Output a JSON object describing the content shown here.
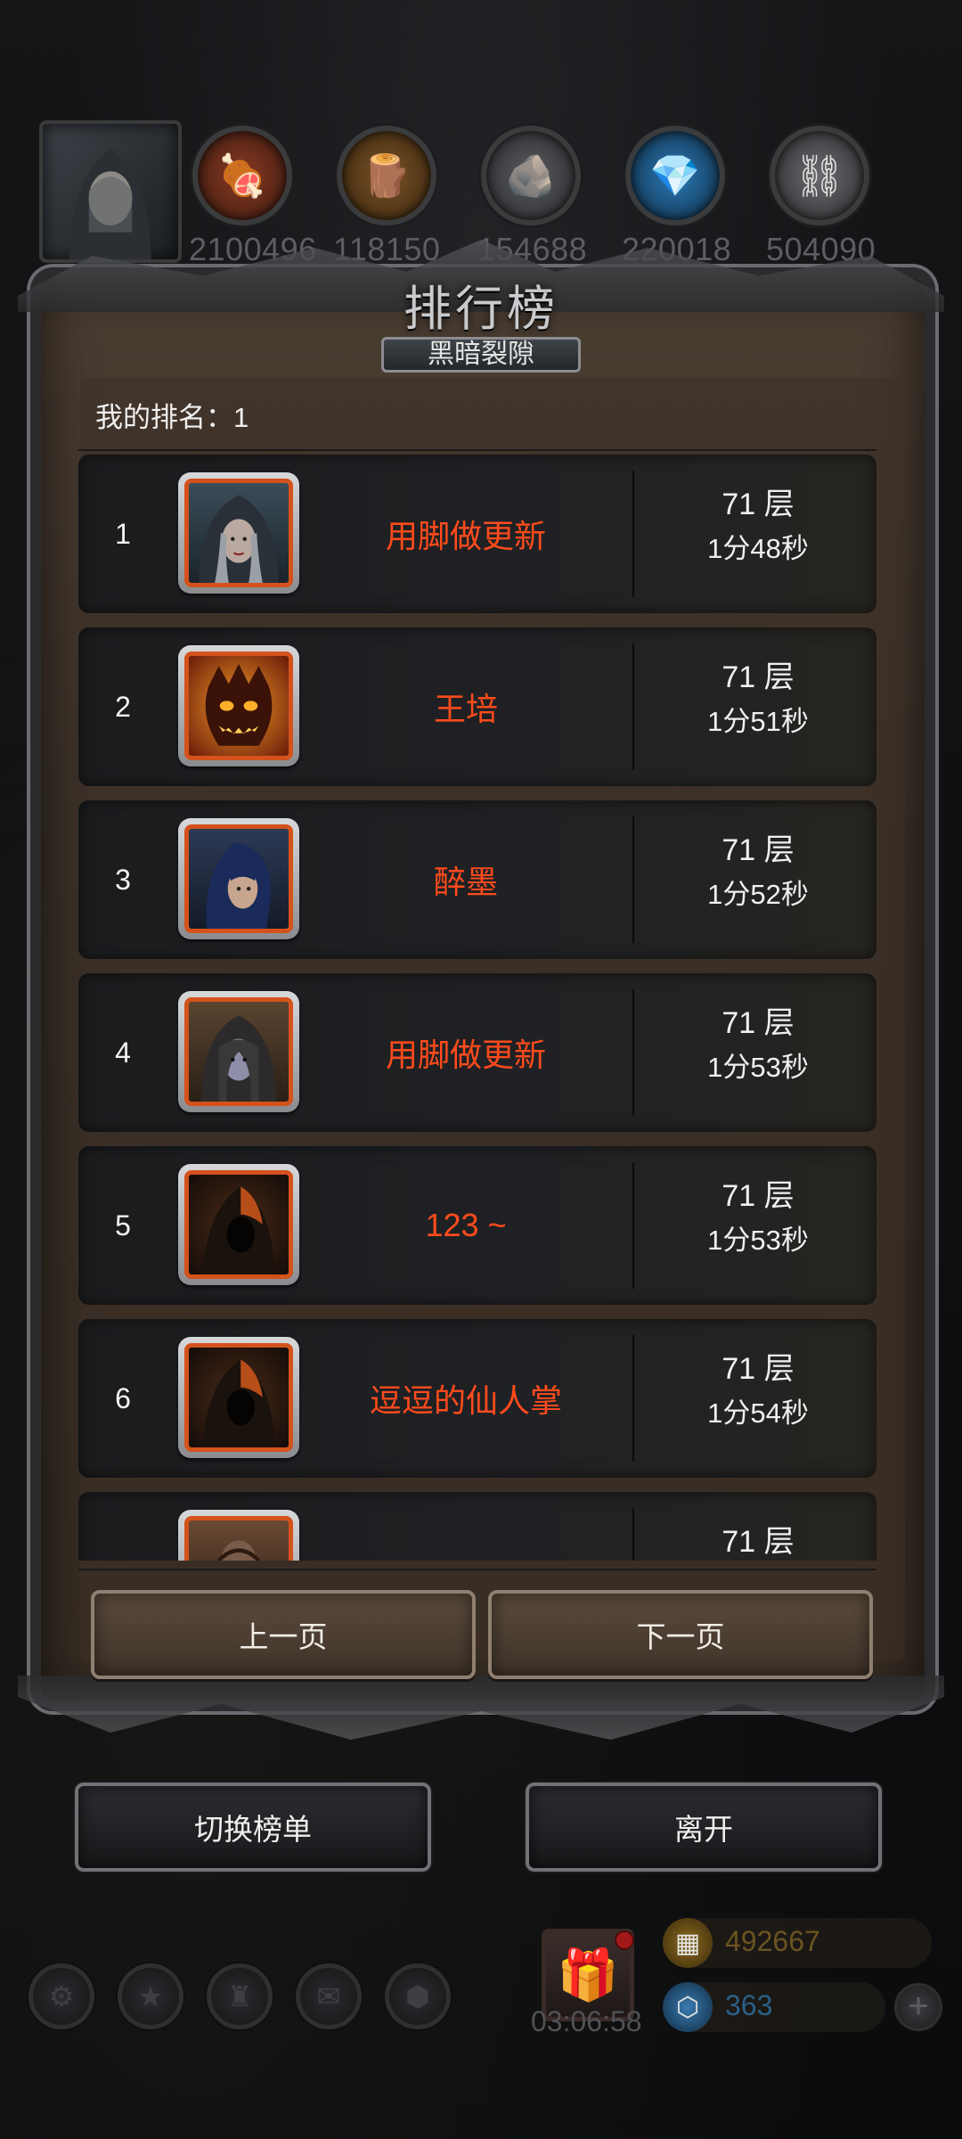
{
  "resources": [
    {
      "name": "meat",
      "icon": "meat-icon",
      "value": "2100496",
      "color": "#7a2f1c"
    },
    {
      "name": "wood",
      "icon": "wood-icon",
      "value": "118150",
      "color": "#7a5225"
    },
    {
      "name": "stone",
      "icon": "stone-icon",
      "value": "154688",
      "color": "#4b4d50"
    },
    {
      "name": "crystal",
      "icon": "crystal-icon",
      "value": "220018",
      "color": "#1d5a8a"
    },
    {
      "name": "iron",
      "icon": "iron-icon",
      "value": "504090",
      "color": "#5a5b5e"
    }
  ],
  "panel": {
    "title": "排行榜",
    "subtitle": "黑暗裂隙",
    "my_rank": "我的排名：1"
  },
  "leaderboard": [
    {
      "rank": "1",
      "name": "用脚做更新",
      "floor": "71 层",
      "time": "1分48秒",
      "portrait": "hooded-woman"
    },
    {
      "rank": "2",
      "name": "王培",
      "floor": "71 层",
      "time": "1分51秒",
      "portrait": "fire-demon"
    },
    {
      "rank": "3",
      "name": "醉墨",
      "floor": "71 层",
      "time": "1分52秒",
      "portrait": "blue-haired-warrior"
    },
    {
      "rank": "4",
      "name": "用脚做更新",
      "floor": "71 层",
      "time": "1分53秒",
      "portrait": "dark-elf"
    },
    {
      "rank": "5",
      "name": "123 ~",
      "floor": "71 层",
      "time": "1分53秒",
      "portrait": "hooded-figure"
    },
    {
      "rank": "6",
      "name": "逗逗的仙人掌",
      "floor": "71 层",
      "time": "1分54秒",
      "portrait": "hooded-figure"
    },
    {
      "rank": "",
      "name": "",
      "floor": "71 层",
      "time": "",
      "portrait": "bald-man"
    }
  ],
  "pagination": {
    "prev_label": "上一页",
    "next_label": "下一页"
  },
  "actions": {
    "switch_label": "切换榜单",
    "leave_label": "离开"
  },
  "dock": {
    "timer": "03:06:58",
    "gold": "492667",
    "gems": "363",
    "gold_color": "#6b5420",
    "gems_color": "#2b5f86"
  },
  "colors": {
    "accent_name": "#ff4b1c",
    "portrait_border": "#d4521c",
    "panel_bg": "#3b3128"
  }
}
